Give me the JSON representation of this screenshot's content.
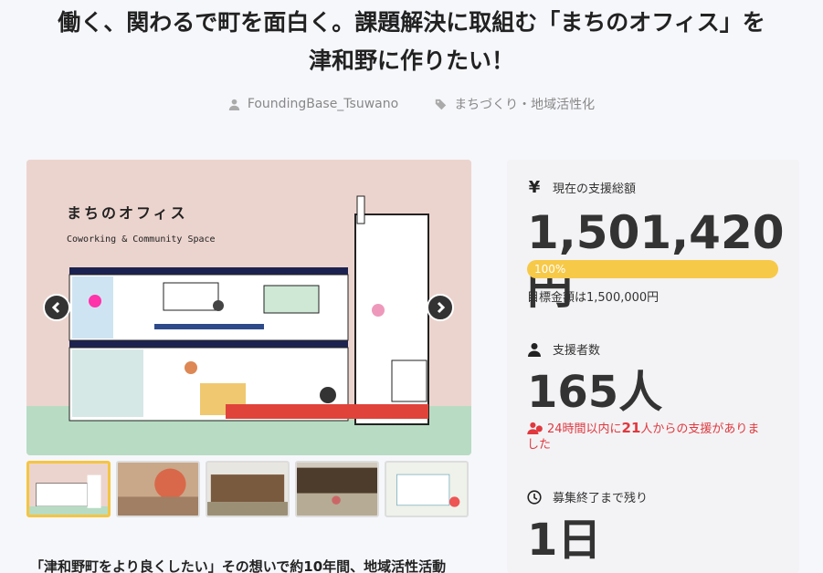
{
  "project": {
    "title_line1": "働く、関わるで町を面白く。課題解決に取組む「まちのオフィス」を",
    "title_line2": "津和野に作りたい！",
    "author": "FoundingBase_Tsuwano",
    "category": "まちづくり・地域活性化",
    "description_start": "「津和野町をより良くしたい」その想いで約10年間、地域活性活動"
  },
  "hero": {
    "sign_title": "まちのオフィス",
    "sign_subtitle": "Coworking & Community Space"
  },
  "thumbnails": [
    {
      "active": true
    },
    {
      "active": false
    },
    {
      "active": false
    },
    {
      "active": false
    },
    {
      "active": false
    }
  ],
  "funding": {
    "label": "現在の支援総額",
    "currency_icon": "¥",
    "amount": "1,501,420円",
    "progress_percent": 100,
    "progress_label": "100%",
    "goal_text": "目標金額は1,500,000円"
  },
  "backers": {
    "label": "支援者数",
    "count": "165人",
    "recent_prefix": "24時間以内に",
    "recent_count": "21",
    "recent_suffix": "人からの支援がありました"
  },
  "remaining": {
    "label": "募集終了まで残り",
    "value": "1日"
  },
  "colors": {
    "accent": "#f7c948",
    "alert": "#e0383e",
    "background": "#f6f7fb"
  }
}
